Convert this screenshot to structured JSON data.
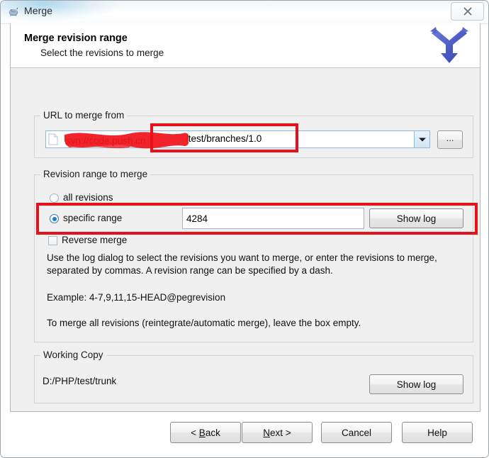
{
  "window": {
    "title": "Merge",
    "app_icon": "tortoise-icon",
    "close_label": "Close"
  },
  "header": {
    "title": "Merge revision range",
    "subtitle": "Select the revisions to merge",
    "logo": "merge-arrow-icon"
  },
  "url_group": {
    "label": "URL to merge from",
    "combo_value": "/test/branches/1.0",
    "combo_redacted": true,
    "browse_label": "...",
    "dropdown_icon": "chevron-down-icon",
    "doc_icon": "document-icon"
  },
  "revision_group": {
    "label": "Revision range to merge",
    "all_revisions_label": "all revisions",
    "all_revisions_selected": false,
    "specific_range_label": "specific range",
    "specific_range_selected": true,
    "revision_value": "4284",
    "show_log_label": "Show log",
    "reverse_merge_label": "Reverse merge",
    "reverse_merge_checked": false,
    "info_line_1": "Use the log dialog to select the revisions you want to merge, or enter the revisions to",
    "info_line_2": "merge, separated by commas. A revision range can be specified by a dash.",
    "info_example": "Example: 4-7,9,11,15-HEAD@pegrevision",
    "info_note": "To merge all revisions (reintegrate/automatic merge), leave the box empty."
  },
  "working_copy": {
    "label": "Working Copy",
    "path": "D:/PHP/test/trunk",
    "show_log_label": "Show log"
  },
  "footer": {
    "back_label": "< Back",
    "next_label": "Next >",
    "cancel_label": "Cancel",
    "help_label": "Help"
  },
  "annotations": {
    "color": "#e8111a",
    "url_box": "highlight-url-path",
    "revision_box": "highlight-specific-range-row"
  }
}
